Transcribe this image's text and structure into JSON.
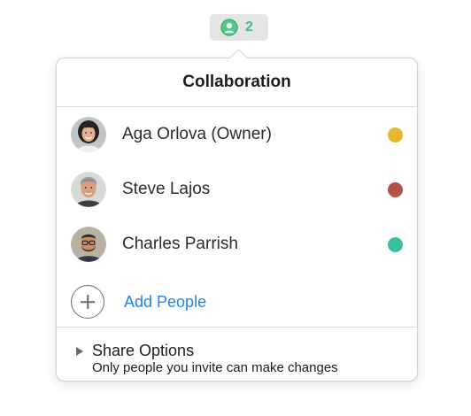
{
  "toolbar": {
    "collaborator_count": "2",
    "count_color": "#3ac07f"
  },
  "popover": {
    "title": "Collaboration",
    "participants": [
      {
        "name": "Aga Orlova (Owner)",
        "status_color": "#e6b92c",
        "avatar": "woman-avatar"
      },
      {
        "name": "Steve Lajos",
        "status_color": "#b35144",
        "avatar": "man-avatar"
      },
      {
        "name": "Charles Parrish",
        "status_color": "#3cbea1",
        "avatar": "man-glasses-avatar"
      }
    ],
    "add_people_label": "Add People",
    "share_options": {
      "title": "Share Options",
      "subtitle": "Only people you invite can make changes"
    }
  },
  "icons": {
    "collab": "person-collaboration-icon",
    "add": "plus-circle-icon",
    "disclosure": "triangle-right-icon"
  }
}
